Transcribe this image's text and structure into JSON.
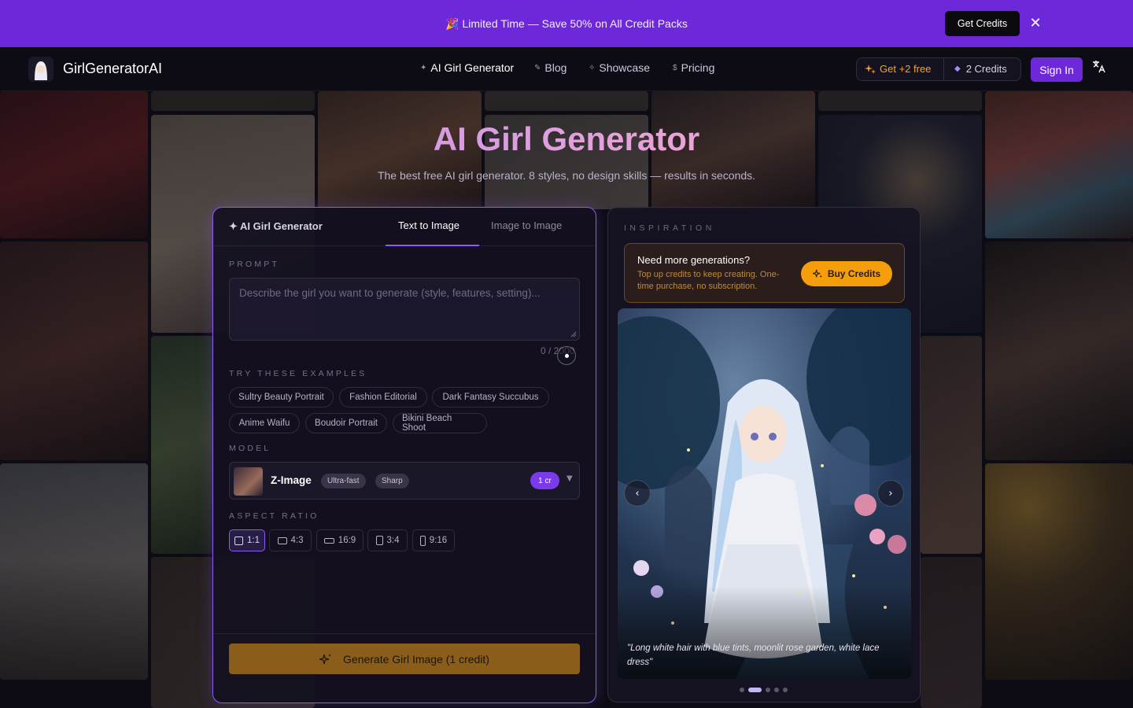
{
  "promo": {
    "text": "🎉 Limited Time — Save 50% on All Credit Packs",
    "cta": "Get Credits",
    "close_icon": "close-icon"
  },
  "header": {
    "brand": "GirlGeneratorAI",
    "nav": [
      {
        "icon": "sparkle-icon",
        "label": "AI Girl Generator",
        "active": true
      },
      {
        "icon": "pencil-icon",
        "label": "Blog",
        "active": false
      },
      {
        "icon": "sparkle-icon",
        "label": "Showcase",
        "active": false
      },
      {
        "icon": "dollar-icon",
        "label": "Pricing",
        "active": false
      }
    ],
    "free_label": "Get +2 free",
    "credits_label": "2 Credits",
    "signin": "Sign In",
    "lang_icon": "translate-icon"
  },
  "hero": {
    "title": "AI Girl Generator",
    "subtitle": "The best free AI girl generator. 8 styles, no design skills — results in seconds."
  },
  "generator": {
    "title": "✦ AI Girl Generator",
    "tabs": [
      "Text to Image",
      "Image to Image"
    ],
    "active_tab": "Text to Image",
    "prompt_label": "PROMPT",
    "prompt_placeholder": "Describe the girl you want to generate (style, features, setting)...",
    "prompt_value": "",
    "counter": "0 / 2000",
    "examples_label": "TRY THESE EXAMPLES",
    "examples": [
      "Sultry Beauty Portrait",
      "Fashion Editorial",
      "Dark Fantasy Succubus",
      "Anime Waifu",
      "Boudoir Portrait",
      "Bikini Beach Shoot"
    ],
    "model_label": "MODEL",
    "model": {
      "name": "Z-Image",
      "tags": [
        "Ultra-fast",
        "Sharp"
      ],
      "cost": "1 cr"
    },
    "aspect_label": "ASPECT RATIO",
    "aspects": [
      "1:1",
      "4:3",
      "16:9",
      "3:4",
      "9:16"
    ],
    "selected_aspect": "1:1",
    "generate_label": "Generate Girl Image (1 credit)"
  },
  "inspiration": {
    "label": "INSPIRATION",
    "upsell_title": "Need more generations?",
    "upsell_desc": "Top up credits to keep creating. One-time purchase, no subscription.",
    "buy_label": "Buy Credits",
    "caption": "\"Long white hair with blue tints, moonlit rose garden, white lace dress\"",
    "slide_count": 5,
    "active_slide": 2
  },
  "colors": {
    "accent": "#6d28d9",
    "accent_light": "#8b5cf6",
    "gold": "#f59e0b",
    "generate_button": "#8a5e1a"
  }
}
